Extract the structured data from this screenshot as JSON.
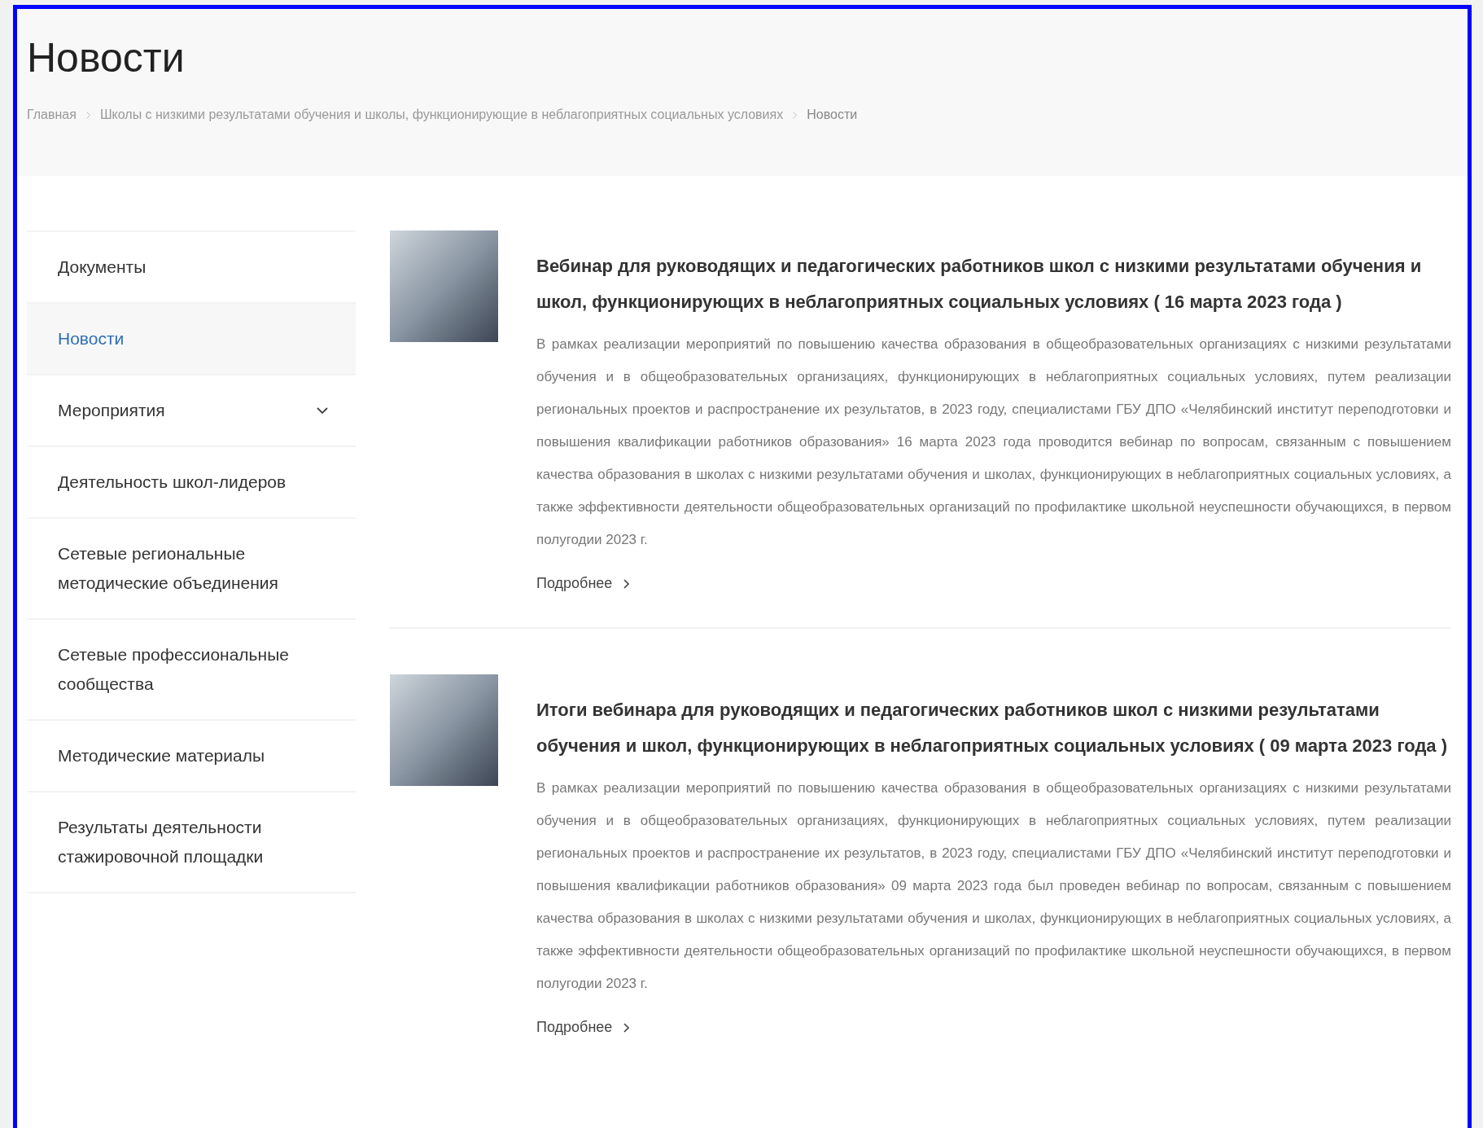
{
  "page": {
    "title": "Новости"
  },
  "breadcrumbs": [
    {
      "label": "Главная",
      "current": false
    },
    {
      "label": "Школы с низкими результатами обучения и школы, функционирующие в неблагоприятных социальных условиях",
      "current": false
    },
    {
      "label": "Новости",
      "current": true
    }
  ],
  "sidebar": {
    "items": [
      {
        "label": "Документы",
        "selected": false,
        "expandable": false
      },
      {
        "label": "Новости",
        "selected": true,
        "expandable": false
      },
      {
        "label": "Мероприятия",
        "selected": false,
        "expandable": true
      },
      {
        "label": "Деятельность школ-лидеров",
        "selected": false,
        "expandable": false
      },
      {
        "label": "Сетевые региональные методические объединения",
        "selected": false,
        "expandable": false
      },
      {
        "label": "Сетевые профессиональные сообщества",
        "selected": false,
        "expandable": false
      },
      {
        "label": "Методические материалы",
        "selected": false,
        "expandable": false
      },
      {
        "label": "Результаты деятельности стажировочной площадки",
        "selected": false,
        "expandable": false
      }
    ]
  },
  "news": [
    {
      "title": "Вебинар для руководящих и педагогических работников школ с низкими результатами обучения и школ, функционирующих в неблагоприятных социальных условиях ( 16 марта 2023 года )",
      "text": "В рамках реализации мероприятий по повышению качества образования в общеобразовательных организациях с низкими результатами обучения и в общеобразовательных организациях, функционирующих в неблагоприятных социальных условиях, путем реализации региональных проектов и распространение их результатов, в 2023 году, специалистами ГБУ ДПО «Челябинский институт переподготовки и повышения квалификации работников образования» 16 марта 2023 года проводится вебинар по вопросам, связанным с повышением качества образования в школах с низкими результатами обучения и школах, функционирующих в неблагоприятных социальных условиях, а также эффективности деятельности общеобразовательных организаций по профилактике школьной неуспешности обучающихся, в первом полугодии 2023 г.",
      "more": "Подробнее"
    },
    {
      "title": "Итоги вебинара для руководящих и педагогических работников школ с низкими результатами обучения и школ, функционирующих в неблагоприятных социальных условиях ( 09 марта 2023 года )",
      "text": "В рамках реализации мероприятий по повышению качества образования в общеобразовательных организациях с низкими результатами обучения и в общеобразовательных организациях, функционирующих в неблагоприятных социальных условиях, путем реализации региональных проектов и распространение их результатов, в 2023 году, специалистами ГБУ ДПО «Челябинский институт переподготовки и повышения квалификации работников образования» 09 марта 2023 года был проведен вебинар по вопросам, связанным с повышением качества образования в школах с низкими результатами обучения и школах, функционирующих в неблагоприятных социальных условиях, а также эффективности деятельности общеобразовательных организаций по профилактике школьной неуспешности обучающихся, в первом полугодии 2023 г.",
      "more": "Подробнее"
    }
  ]
}
